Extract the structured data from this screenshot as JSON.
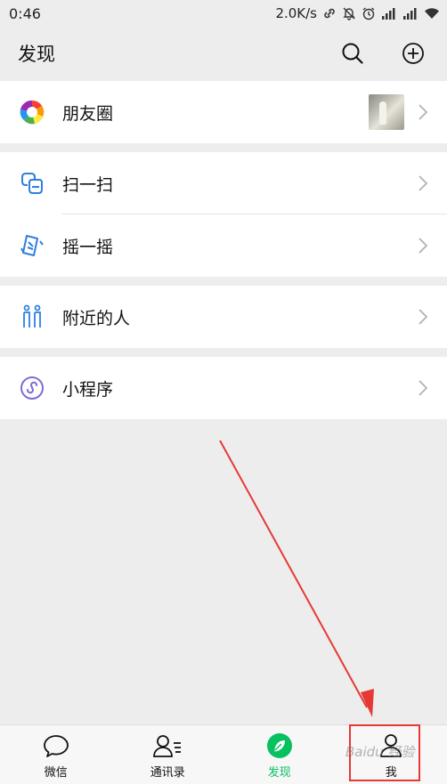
{
  "status_bar": {
    "time": "0:46",
    "net_speed": "2.0K/s"
  },
  "header": {
    "title": "发现"
  },
  "groups": [
    {
      "items": [
        {
          "label": "朋友圈",
          "icon": "moments-icon"
        }
      ]
    },
    {
      "items": [
        {
          "label": "扫一扫",
          "icon": "scan-icon"
        },
        {
          "label": "摇一摇",
          "icon": "shake-icon"
        }
      ]
    },
    {
      "items": [
        {
          "label": "附近的人",
          "icon": "nearby-people-icon"
        }
      ]
    },
    {
      "items": [
        {
          "label": "小程序",
          "icon": "mini-program-icon"
        }
      ]
    }
  ],
  "tabs": [
    {
      "label": "微信",
      "icon": "chat-bubble-icon"
    },
    {
      "label": "通讯录",
      "icon": "contacts-icon"
    },
    {
      "label": "发现",
      "icon": "compass-icon",
      "active": true
    },
    {
      "label": "我",
      "icon": "person-icon"
    }
  ],
  "colors": {
    "accent": "#07c160",
    "annotation": "#e53935",
    "background": "#ededed"
  },
  "watermark": "Baidu 经验"
}
